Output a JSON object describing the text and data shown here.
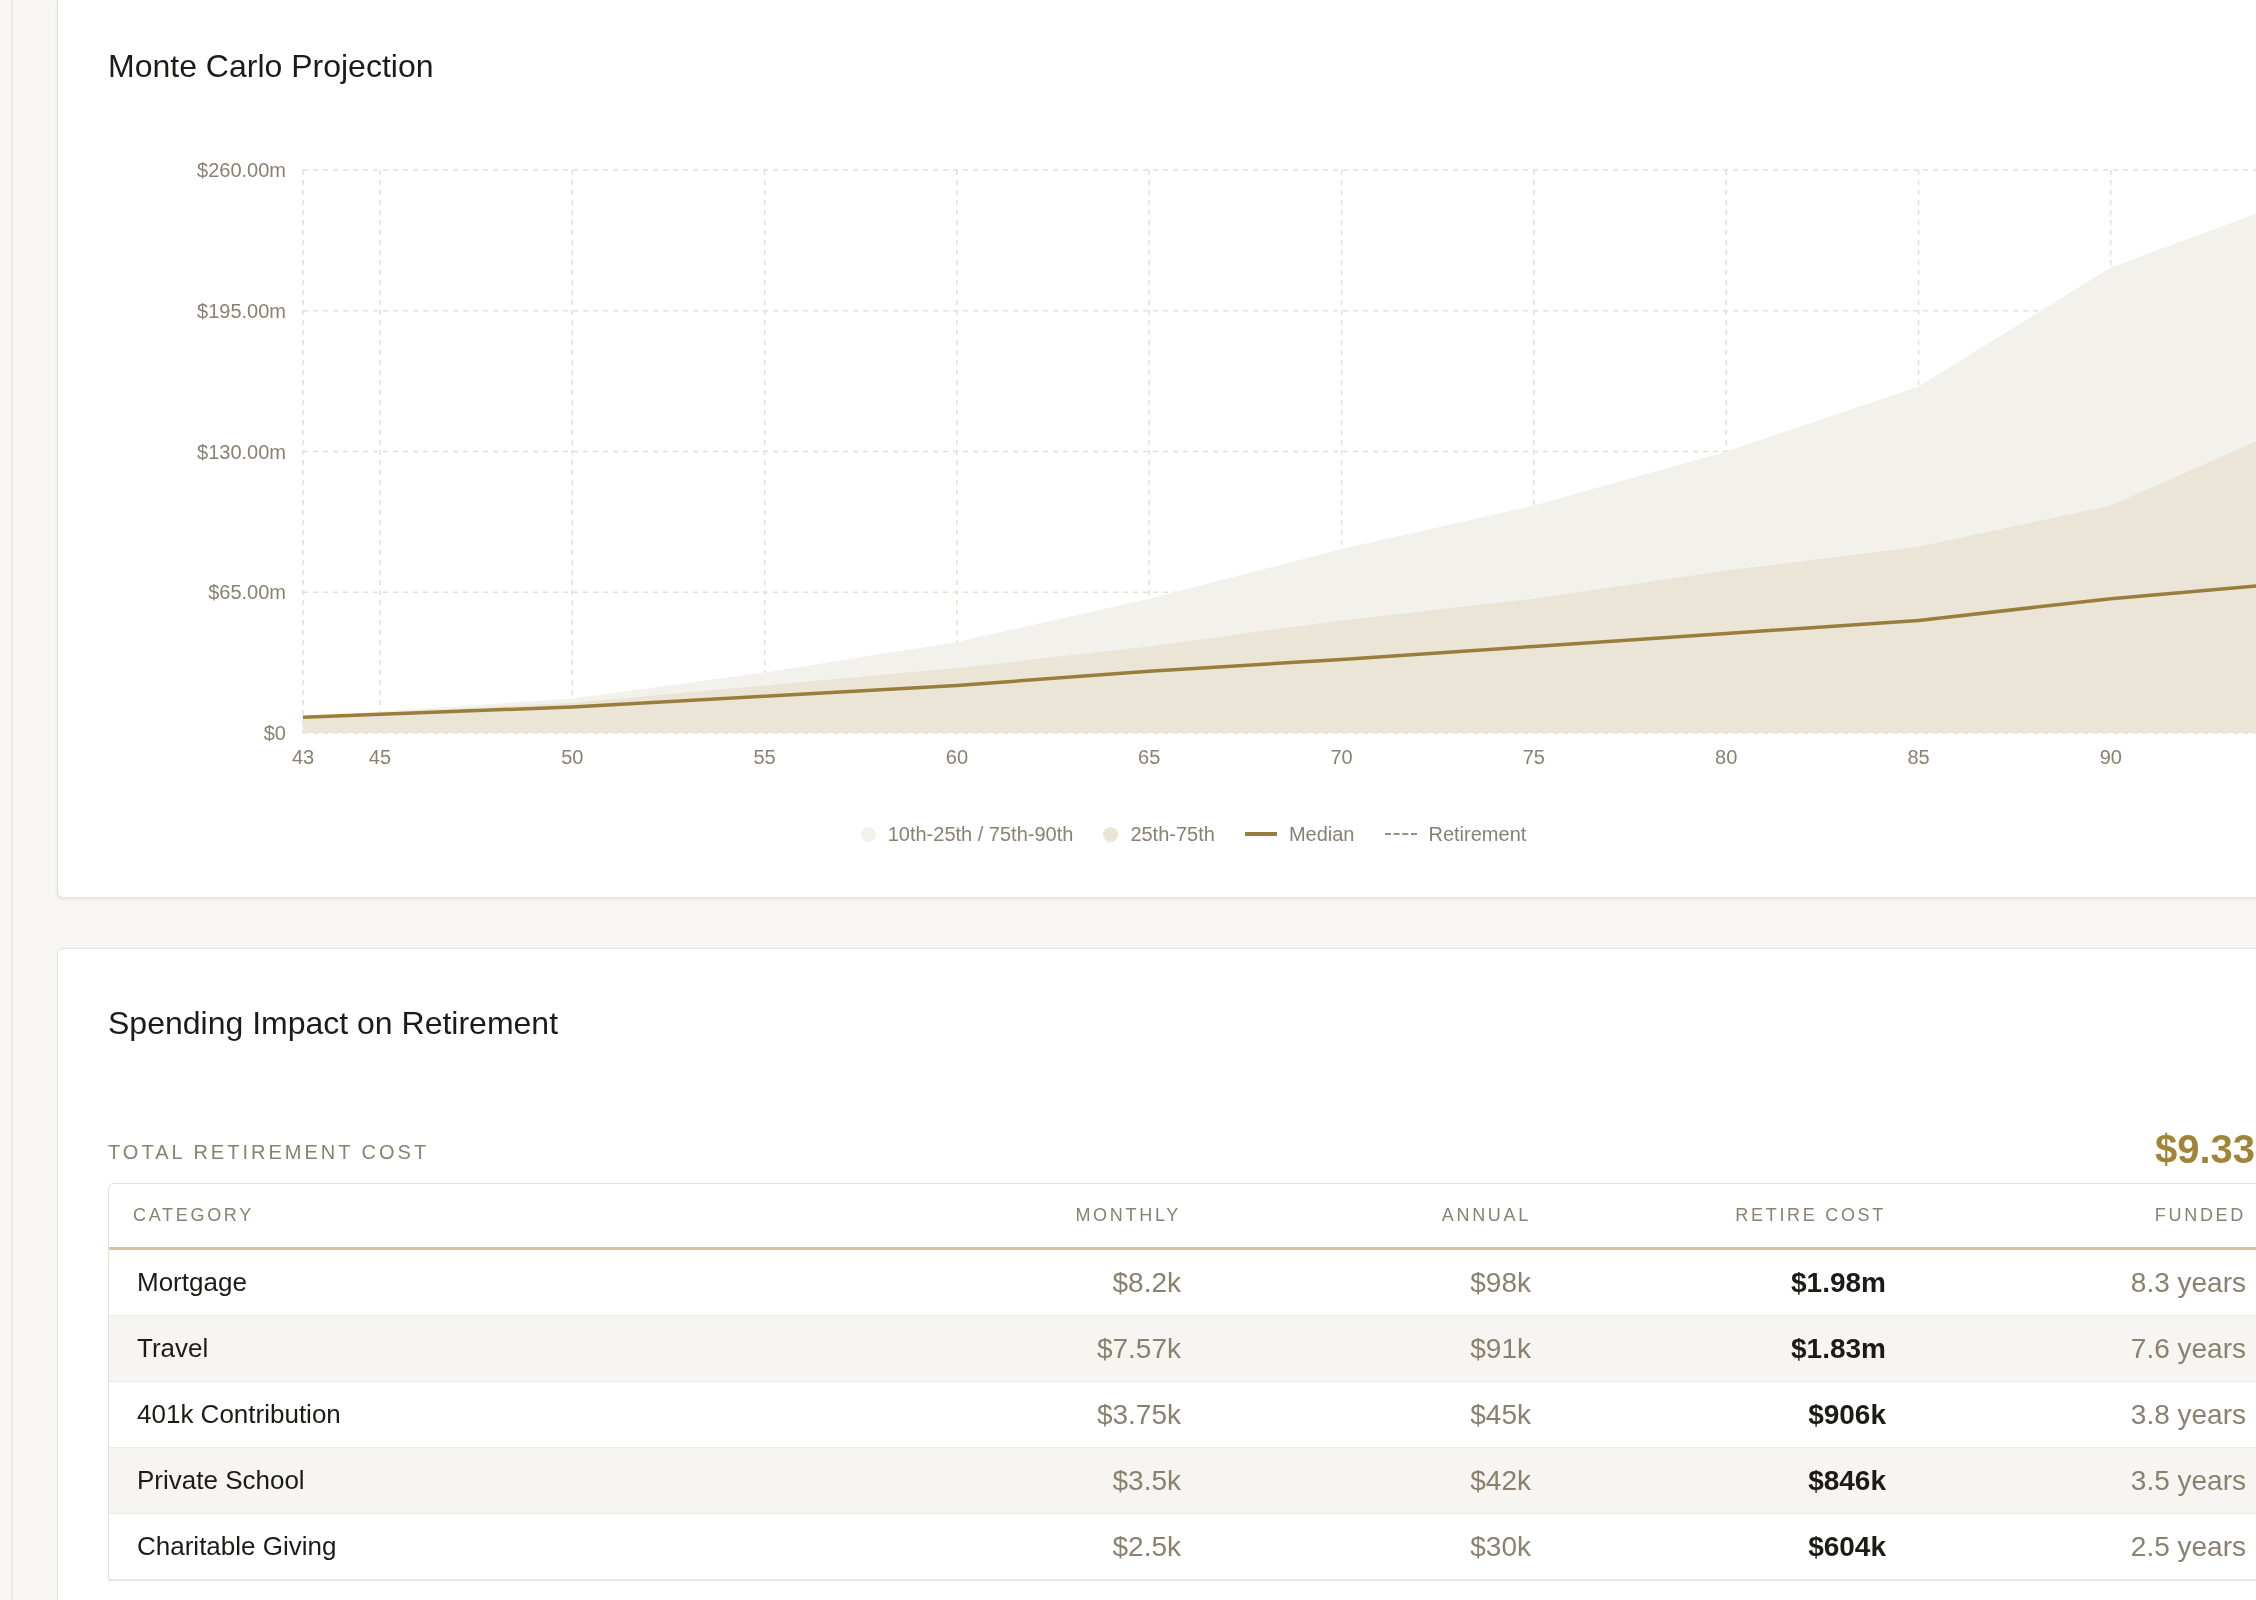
{
  "projection": {
    "title": "Monte Carlo Projection",
    "chart_data": {
      "type": "area",
      "xlim": [
        43,
        93.8
      ],
      "ylim": [
        0,
        260
      ],
      "xticks": [
        43,
        45,
        50,
        55,
        60,
        65,
        70,
        75,
        80,
        85,
        90
      ],
      "yticks": [
        {
          "value": 0,
          "label": "$0"
        },
        {
          "value": 65,
          "label": "$65.00m"
        },
        {
          "value": 130,
          "label": "$130.00m"
        },
        {
          "value": 195,
          "label": "$195.00m"
        },
        {
          "value": 260,
          "label": "$260.00m"
        }
      ],
      "grid": true,
      "x": [
        43,
        50,
        55,
        60,
        65,
        70,
        75,
        80,
        85,
        90,
        93.8
      ],
      "series": [
        {
          "name": "10th-25th / 75th-90th",
          "type": "area",
          "color": "#f3f1eb",
          "values": [
            7.5,
            16,
            28,
            42,
            62,
            85,
            105,
            130,
            160,
            215,
            240
          ]
        },
        {
          "name": "25th-75th",
          "type": "area",
          "color": "#ebe5d8",
          "values": [
            7.5,
            14,
            22,
            30,
            40,
            52,
            62,
            75,
            86,
            105,
            135
          ]
        },
        {
          "name": "Median",
          "type": "line",
          "color": "#9a7d3a",
          "values": [
            7.3,
            12,
            17,
            22,
            28.5,
            34,
            40,
            46,
            52,
            62,
            68
          ]
        }
      ]
    },
    "retirement_legend": {
      "label": "Retirement",
      "color": "#9a9080"
    }
  },
  "spending": {
    "title": "Spending Impact on Retirement",
    "total_label": "TOTAL RETIREMENT COST",
    "total_value": "$9.33",
    "table": {
      "columns": [
        "CATEGORY",
        "MONTHLY",
        "ANNUAL",
        "RETIRE COST",
        "FUNDED"
      ],
      "rows": [
        {
          "category": "Mortgage",
          "monthly": "$8.2k",
          "annual": "$98k",
          "retire_cost": "$1.98m",
          "funded": "8.3 years"
        },
        {
          "category": "Travel",
          "monthly": "$7.57k",
          "annual": "$91k",
          "retire_cost": "$1.83m",
          "funded": "7.6 years"
        },
        {
          "category": "401k Contribution",
          "monthly": "$3.75k",
          "annual": "$45k",
          "retire_cost": "$906k",
          "funded": "3.8 years"
        },
        {
          "category": "Private School",
          "monthly": "$3.5k",
          "annual": "$42k",
          "retire_cost": "$846k",
          "funded": "3.5 years"
        },
        {
          "category": "Charitable Giving",
          "monthly": "$2.5k",
          "annual": "$30k",
          "retire_cost": "$604k",
          "funded": "2.5 years"
        }
      ]
    }
  }
}
